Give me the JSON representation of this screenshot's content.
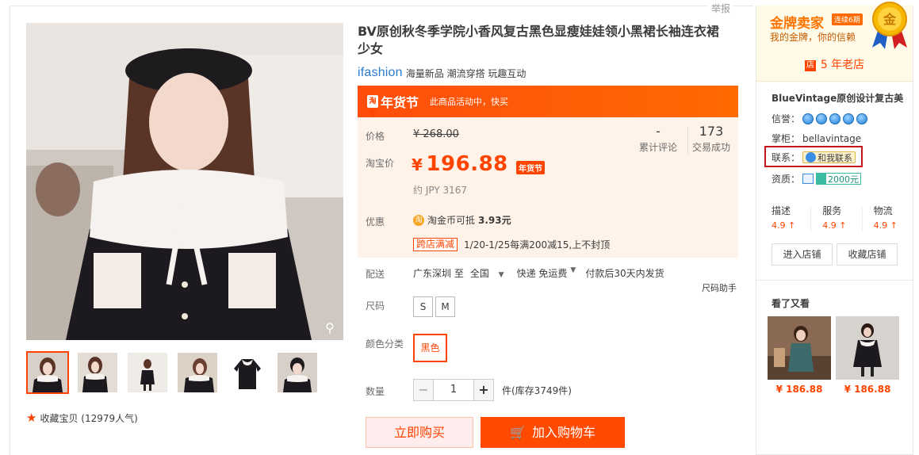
{
  "header": {
    "report": "举报"
  },
  "gallery": {
    "thumb_count": 6,
    "favorite": "收藏宝贝 (12979人气)"
  },
  "product": {
    "title": "BV原创秋冬季学院小香风复古黑色显瘦娃娃领小黑裙长袖连衣裙少女",
    "brand_logo": "ifashion",
    "brand_tags": "海量新品 潮流穿搭 玩趣互动"
  },
  "promo": {
    "badge_box": "淘宝",
    "badge": "年货节",
    "note": "此商品活动中，快买"
  },
  "price": {
    "orig_label": "价格",
    "orig_value": "¥ 268.00",
    "cur_label": "淘宝价",
    "yen": "¥",
    "cur_value": "196.88",
    "tag": "年货节",
    "jpy": "约 JPY 3167",
    "reviews_num": "-",
    "reviews_label": "累计评论",
    "sales_num": "173",
    "sales_label": "交易成功"
  },
  "discount": {
    "label": "优惠",
    "coin_icon": "淘",
    "coin_text": "淘金币可抵",
    "coin_amount": "3.93元",
    "cross_tag": "跨店满减",
    "cross_text": "1/20-1/25每满200减15,上不封顶"
  },
  "delivery": {
    "label": "配送",
    "origin": "广东深圳 至",
    "dest": "全国",
    "method": "快递 免运费",
    "ship": "付款后30天内发货"
  },
  "size_helper": "尺码助手",
  "options": {
    "size_label": "尺码",
    "sizes": [
      "S",
      "M"
    ],
    "color_label": "颜色分类",
    "color": "黑色"
  },
  "quantity": {
    "label": "数量",
    "minus": "−",
    "value": "1",
    "plus": "+",
    "stock": "件(库存3749件)"
  },
  "actions": {
    "buy": "立即购买",
    "cart": "加入购物车"
  },
  "seller": {
    "gold_title": "金牌卖家",
    "gold_ribbon": "连续6期",
    "gold_sub": "我的金牌，你的信赖",
    "medal_char": "金",
    "shop_icon": "店",
    "years": "5 年老店",
    "shop_name": "BlueVintage原创设计复古美",
    "credit_label": "信誉：",
    "owner_label": "掌柜：",
    "owner": "bellavintage",
    "contact_label": "联系：",
    "contact_btn": "和我联系",
    "qual_label": "资质：",
    "deposit": "2000元",
    "scores": [
      {
        "label": "描述",
        "value": "4.9 ↑"
      },
      {
        "label": "服务",
        "value": "4.9 ↑"
      },
      {
        "label": "物流",
        "value": "4.9 ↑"
      }
    ],
    "enter": "进入店铺",
    "collect": "收藏店铺",
    "see_again": "看了又看",
    "recs": [
      {
        "price": "¥ 186.88"
      },
      {
        "price": "¥ 186.88"
      }
    ]
  }
}
